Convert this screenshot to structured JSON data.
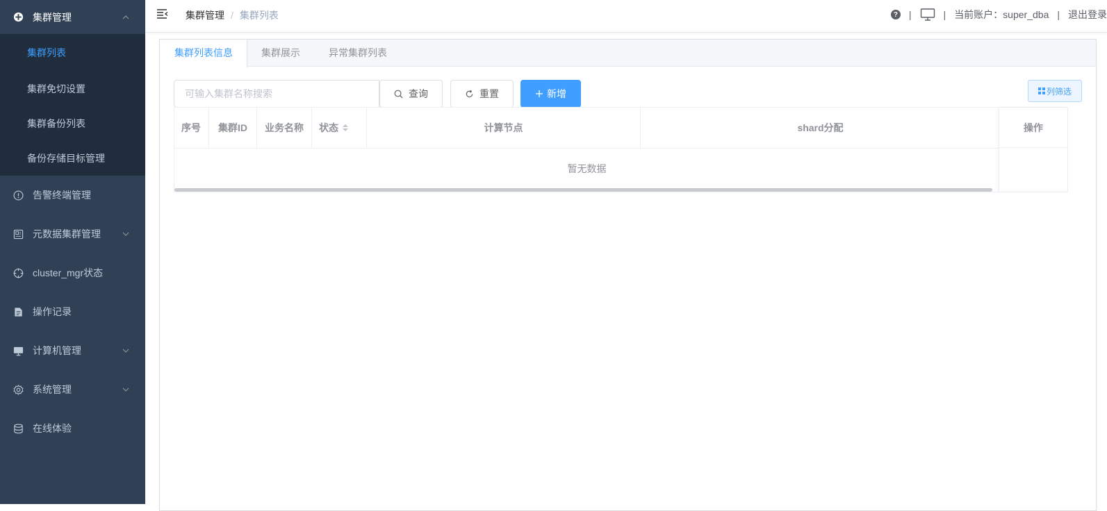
{
  "sidebar": {
    "group_cluster": {
      "label": "集群管理",
      "icon": "cluster-icon",
      "expanded": true
    },
    "submenu": [
      {
        "label": "集群列表",
        "active": true
      },
      {
        "label": "集群免切设置"
      },
      {
        "label": "集群备份列表"
      },
      {
        "label": "备份存储目标管理"
      }
    ],
    "items": [
      {
        "label": "告警终端管理",
        "icon": "alert-circle-icon"
      },
      {
        "label": "元数据集群管理",
        "icon": "metadata-icon",
        "has_arrow": true
      },
      {
        "label": "cluster_mgr状态",
        "icon": "crosshair-icon"
      },
      {
        "label": "操作记录",
        "icon": "document-icon"
      },
      {
        "label": "计算机管理",
        "icon": "computer-icon",
        "has_arrow": true
      },
      {
        "label": "系统管理",
        "icon": "gear-icon",
        "has_arrow": true
      },
      {
        "label": "在线体验",
        "icon": "database-icon"
      }
    ]
  },
  "header": {
    "breadcrumb": [
      "集群管理",
      "集群列表"
    ],
    "separator": "/",
    "right_sep": "|",
    "account_label": "当前账户：super_dba",
    "logout": "退出登录"
  },
  "tabs": [
    {
      "label": "集群列表信息",
      "active": true
    },
    {
      "label": "集群展示"
    },
    {
      "label": "异常集群列表"
    }
  ],
  "toolbar": {
    "search_placeholder": "可输入集群名称搜索",
    "search_value": "",
    "query": "查询",
    "reset": "重置",
    "add": "新增",
    "filter": "列筛选"
  },
  "table": {
    "columns": [
      "序号",
      "集群ID",
      "业务名称",
      "状态",
      "计算节点",
      "shard分配",
      "操作"
    ],
    "rows": [],
    "empty_text": "暂无数据"
  },
  "colors": {
    "sidebar_bg": "#304156",
    "submenu_bg": "#1f2d3d",
    "accent": "#409eff"
  }
}
